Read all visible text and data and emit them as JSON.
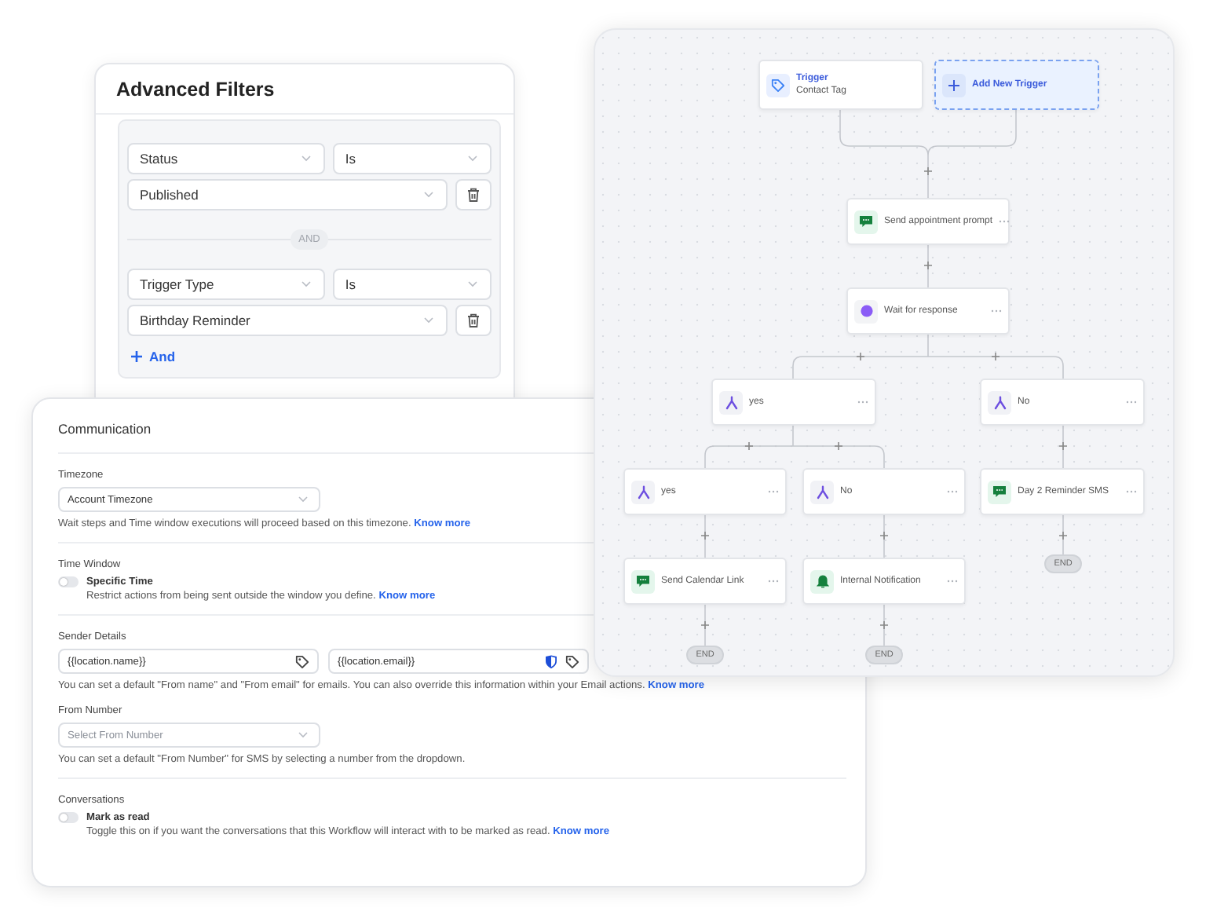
{
  "advanced_filters": {
    "title": "Advanced Filters",
    "conditions": [
      {
        "field": "Status",
        "operator": "Is",
        "value": "Published"
      },
      {
        "field": "Trigger Type",
        "operator": "Is",
        "value": "Birthday Reminder"
      }
    ],
    "joiner": "AND",
    "add_label": "And"
  },
  "communication": {
    "title": "Communication",
    "sections": [
      {
        "items": [
          {
            "kind": "select",
            "label": "Timezone",
            "value": "Account Timezone",
            "help": "Wait steps and Time window executions will proceed based on this timezone.",
            "link": "Know more"
          }
        ]
      },
      {
        "items": [
          {
            "kind": "toggle",
            "label": "Time Window",
            "toggle_label": "Specific Time",
            "on": false,
            "help": "Restrict actions from being sent outside the window you define.",
            "link": "Know more"
          }
        ]
      },
      {
        "items": [
          {
            "kind": "inputs",
            "label": "Sender Details",
            "fields": [
              "{{location.name}}",
              "{{location.email}}"
            ],
            "help": "You can set a default \"From name\" and \"From email\" for emails. You can also override this information within your Email actions.",
            "link": "Know more"
          },
          {
            "kind": "select",
            "label": "From Number",
            "placeholder": "Select From Number",
            "help": "You can set a default \"From Number\" for SMS by selecting a number from the dropdown."
          }
        ]
      },
      {
        "items": [
          {
            "kind": "toggle",
            "label": "Conversations",
            "toggle_label": "Mark as read",
            "on": false,
            "help": "Toggle this on if you want the conversations that this Workflow will interact with to be marked as read.",
            "link": "Know more"
          }
        ]
      }
    ]
  },
  "workflow": {
    "nodes": [
      {
        "kind": "trigger",
        "title": "Trigger",
        "label": "Contact Tag"
      },
      {
        "kind": "add",
        "label": "Add New Trigger"
      },
      {
        "kind": "message",
        "label": "Send appointment prompt"
      },
      {
        "kind": "wait",
        "label": "Wait for response"
      },
      {
        "kind": "branch",
        "label": "yes"
      },
      {
        "kind": "branch",
        "label": "No"
      },
      {
        "kind": "branch",
        "label": "yes"
      },
      {
        "kind": "branch",
        "label": "No"
      },
      {
        "kind": "message",
        "label": "Day 2 Reminder SMS"
      },
      {
        "kind": "message",
        "label": "Send Calendar Link"
      },
      {
        "kind": "notification",
        "label": "Internal Notification"
      },
      {
        "kind": "end",
        "label": "END"
      },
      {
        "kind": "end",
        "label": "END"
      },
      {
        "kind": "end",
        "label": "END"
      }
    ]
  }
}
